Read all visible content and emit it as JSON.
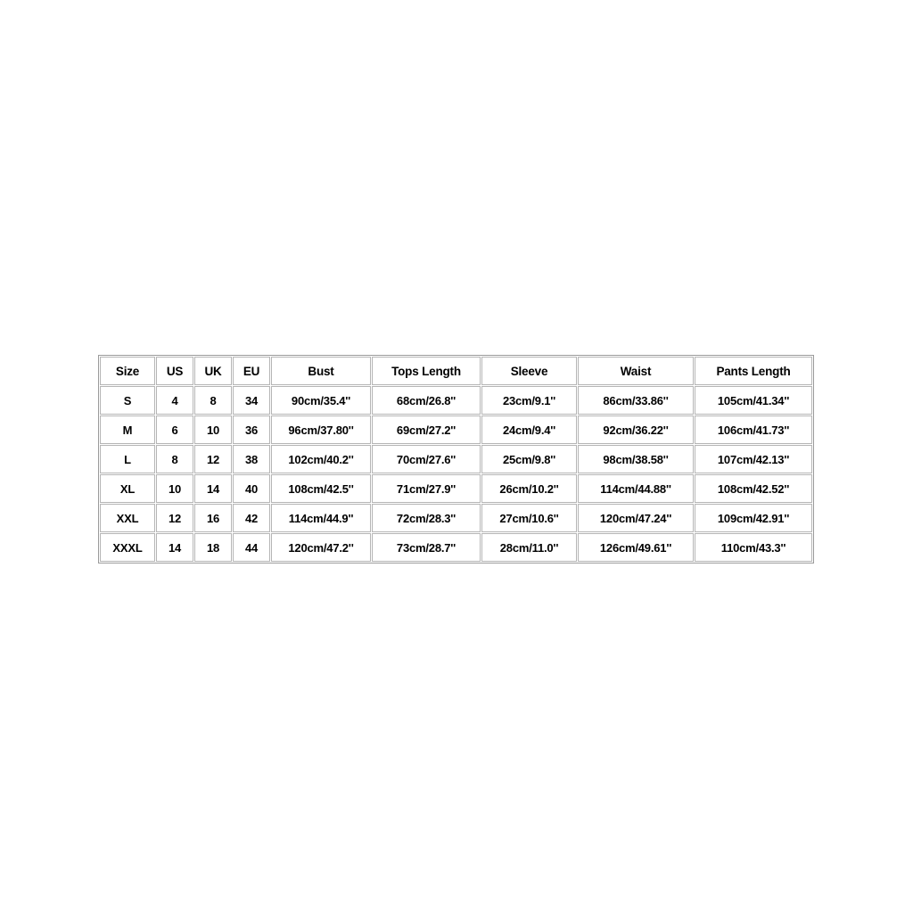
{
  "document": {
    "type": "size-chart",
    "background_color": "#ffffff",
    "text_color": "#000000",
    "border_color": "#b5b5b5"
  },
  "table": {
    "headers": [
      "Size",
      "US",
      "UK",
      "EU",
      "Bust",
      "Tops Length",
      "Sleeve",
      "Waist",
      "Pants Length"
    ],
    "rows": [
      {
        "size": "S",
        "us": "4",
        "uk": "8",
        "eu": "34",
        "bust": "90cm/35.4''",
        "tops_length": "68cm/26.8''",
        "sleeve": "23cm/9.1''",
        "waist": "86cm/33.86''",
        "pants_length": "105cm/41.34''"
      },
      {
        "size": "M",
        "us": "6",
        "uk": "10",
        "eu": "36",
        "bust": "96cm/37.80''",
        "tops_length": "69cm/27.2''",
        "sleeve": "24cm/9.4''",
        "waist": "92cm/36.22''",
        "pants_length": "106cm/41.73''"
      },
      {
        "size": "L",
        "us": "8",
        "uk": "12",
        "eu": "38",
        "bust": "102cm/40.2''",
        "tops_length": "70cm/27.6''",
        "sleeve": "25cm/9.8''",
        "waist": "98cm/38.58''",
        "pants_length": "107cm/42.13''"
      },
      {
        "size": "XL",
        "us": "10",
        "uk": "14",
        "eu": "40",
        "bust": "108cm/42.5''",
        "tops_length": "71cm/27.9''",
        "sleeve": "26cm/10.2''",
        "waist": "114cm/44.88''",
        "pants_length": "108cm/42.52''"
      },
      {
        "size": "XXL",
        "us": "12",
        "uk": "16",
        "eu": "42",
        "bust": "114cm/44.9''",
        "tops_length": "72cm/28.3''",
        "sleeve": "27cm/10.6''",
        "waist": "120cm/47.24''",
        "pants_length": "109cm/42.91''"
      },
      {
        "size": "XXXL",
        "us": "14",
        "uk": "18",
        "eu": "44",
        "bust": "120cm/47.2''",
        "tops_length": "73cm/28.7''",
        "sleeve": "28cm/11.0''",
        "waist": "126cm/49.61''",
        "pants_length": "110cm/43.3''"
      }
    ]
  }
}
